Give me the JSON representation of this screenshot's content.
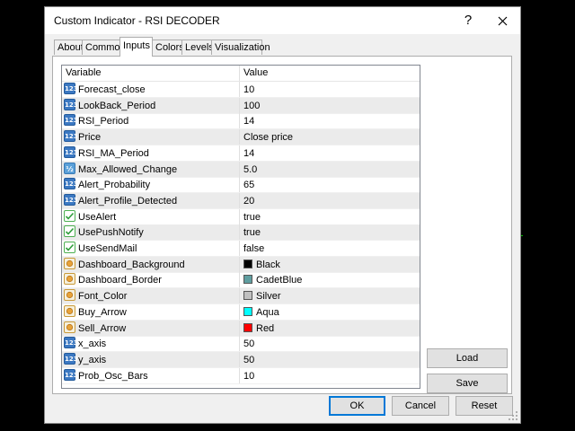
{
  "window": {
    "title": "Custom Indicator - RSI DECODER",
    "help_label": "?",
    "close_label": "✕"
  },
  "tabs": [
    {
      "label": "About"
    },
    {
      "label": "Common"
    },
    {
      "label": "Inputs"
    },
    {
      "label": "Colors"
    },
    {
      "label": "Levels"
    },
    {
      "label": "Visualization"
    }
  ],
  "active_tab": "Inputs",
  "grid": {
    "headers": {
      "variable": "Variable",
      "value": "Value"
    },
    "rows": [
      {
        "type": "int",
        "type_icon": "123",
        "variable": "Forecast_close",
        "value": "10"
      },
      {
        "type": "int",
        "type_icon": "123",
        "variable": "LookBack_Period",
        "value": "100"
      },
      {
        "type": "int",
        "type_icon": "123",
        "variable": "RSI_Period",
        "value": "14"
      },
      {
        "type": "int",
        "type_icon": "123",
        "variable": "Price",
        "value": "Close price"
      },
      {
        "type": "int",
        "type_icon": "123",
        "variable": "RSI_MA_Period",
        "value": "14"
      },
      {
        "type": "double",
        "type_icon": "½",
        "variable": "Max_Allowed_Change",
        "value": "5.0"
      },
      {
        "type": "int",
        "type_icon": "123",
        "variable": "Alert_Probability",
        "value": "65"
      },
      {
        "type": "int",
        "type_icon": "123",
        "variable": "Alert_Profile_Detected",
        "value": "20"
      },
      {
        "type": "bool",
        "type_icon": "",
        "variable": "UseAlert",
        "value": "true"
      },
      {
        "type": "bool",
        "type_icon": "",
        "variable": "UsePushNotify",
        "value": "true"
      },
      {
        "type": "bool",
        "type_icon": "",
        "variable": "UseSendMail",
        "value": "false"
      },
      {
        "type": "color",
        "type_icon": "",
        "variable": "Dashboard_Background",
        "value": "Black",
        "swatch": "#000000"
      },
      {
        "type": "color",
        "type_icon": "",
        "variable": "Dashboard_Border",
        "value": "CadetBlue",
        "swatch": "#5f9ea0"
      },
      {
        "type": "color",
        "type_icon": "",
        "variable": "Font_Color",
        "value": "Silver",
        "swatch": "#c0c0c0"
      },
      {
        "type": "color",
        "type_icon": "",
        "variable": "Buy_Arrow",
        "value": "Aqua",
        "swatch": "#00ffff"
      },
      {
        "type": "color",
        "type_icon": "",
        "variable": "Sell_Arrow",
        "value": "Red",
        "swatch": "#ff0000"
      },
      {
        "type": "int",
        "type_icon": "123",
        "variable": "x_axis",
        "value": "50"
      },
      {
        "type": "int",
        "type_icon": "123",
        "variable": "y_axis",
        "value": "50"
      },
      {
        "type": "int",
        "type_icon": "123",
        "variable": "Prob_Osc_Bars",
        "value": "10"
      }
    ]
  },
  "side_buttons": {
    "load": "Load",
    "save": "Save"
  },
  "footer_buttons": {
    "ok": "OK",
    "cancel": "Cancel",
    "reset": "Reset"
  },
  "colors": {
    "accent": "#0078d7",
    "background": "#000000",
    "chart_marks": "#00c000"
  }
}
